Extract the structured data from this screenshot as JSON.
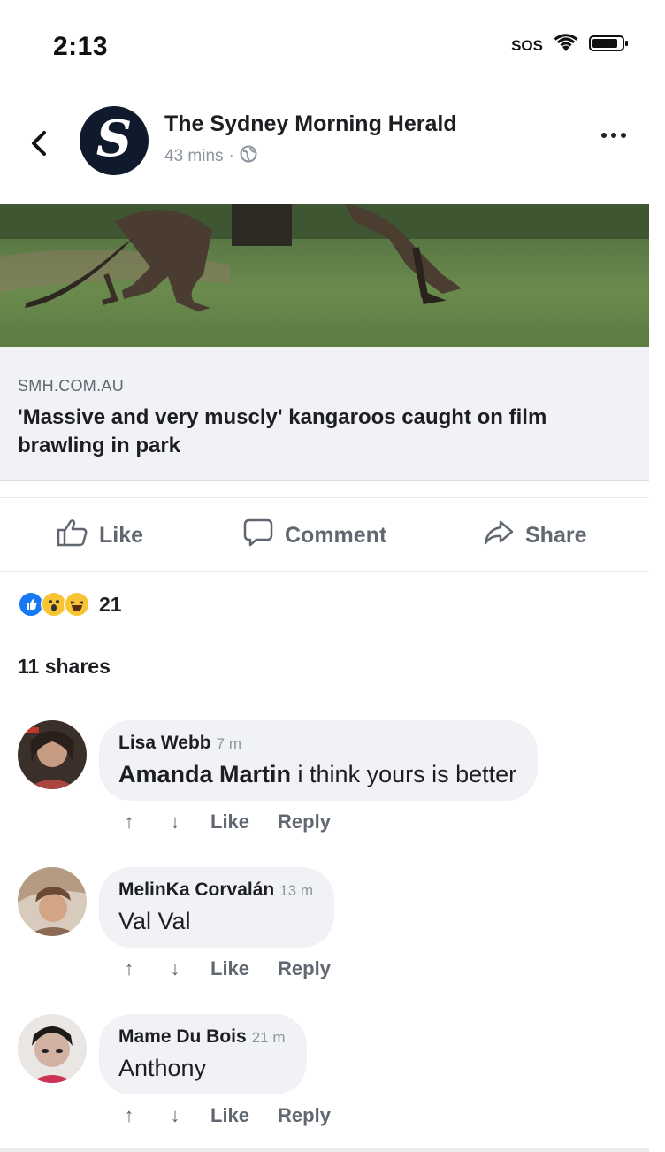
{
  "status_bar": {
    "time": "2:13",
    "carrier": "SOS"
  },
  "header": {
    "page_name": "The Sydney Morning Herald",
    "avatar_letter": "S",
    "time": "43 mins",
    "separator": "·"
  },
  "link": {
    "domain": "SMH.COM.AU",
    "title": "'Massive and very muscly' kangaroos caught on film brawling in  park"
  },
  "actions": {
    "like": "Like",
    "comment": "Comment",
    "share": "Share"
  },
  "reactions": {
    "icons": [
      "like",
      "wow",
      "haha"
    ],
    "count": "21"
  },
  "shares": "11 shares",
  "comments": [
    {
      "author": "Lisa Webb",
      "time": "7 m",
      "mention": "Amanda Martin",
      "text": " i think yours is better",
      "like": "Like",
      "reply": "Reply",
      "up": "↑",
      "down": "↓"
    },
    {
      "author": "MelinKa Corvalán",
      "time": "13 m",
      "mention": "",
      "text": "Val Val",
      "like": "Like",
      "reply": "Reply",
      "up": "↑",
      "down": "↓"
    },
    {
      "author": "Mame Du Bois",
      "time": "21 m",
      "mention": "",
      "text": "Anthony",
      "like": "Like",
      "reply": "Reply",
      "up": "↑",
      "down": "↓"
    }
  ],
  "colors": {
    "accent": "#1877f2",
    "avatar_bg": "#0f1a2c",
    "link_bg": "#f0f2f5"
  }
}
